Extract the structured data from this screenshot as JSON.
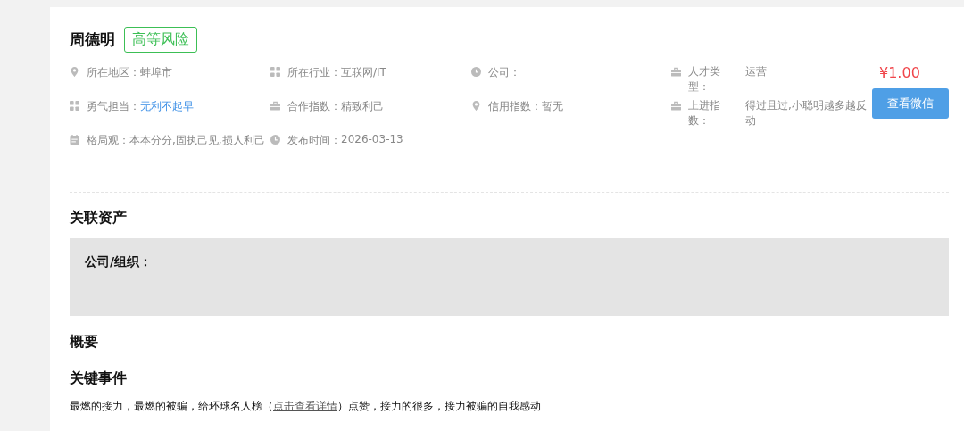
{
  "profile": {
    "name": "周德明",
    "risk_tag": "高等风险",
    "fields": [
      {
        "label": "所在地区：",
        "value": "蚌埠市",
        "kind": "text"
      },
      {
        "label": "所在行业：",
        "value": "互联网/IT",
        "kind": "text"
      },
      {
        "label": "公司：",
        "kind": "text"
      },
      {
        "label": "人才类型：",
        "value": "运营",
        "kind": "text"
      },
      {
        "label": "勇气担当：",
        "value": "无利不起早",
        "kind": "link"
      },
      {
        "label": "合作指数：",
        "value": "精致利己",
        "kind": "text"
      },
      {
        "label": "信用指数：",
        "value": "暂无",
        "kind": "text"
      },
      {
        "label": "上进指数：",
        "value": "得过且过,小聪明越多越反动",
        "kind": "text"
      },
      {
        "label": "格局观：",
        "value": "本本分分,固执己见,损人利己",
        "kind": "text"
      },
      {
        "label": "发布时间：",
        "value": "2026-03-13",
        "kind": "text"
      }
    ],
    "price": "¥1.00",
    "button": "查看微信"
  },
  "assets": {
    "title": "关联资产",
    "org_label": "公司/组织："
  },
  "summary": {
    "title": "概要"
  },
  "events": {
    "title": "关键事件",
    "text_before": "最燃的接力，最燃的被骗，给环球名人榜（",
    "link": "点击查看详情",
    "text_after": "）点赞，接力的很多，接力被骗的自我感动"
  }
}
